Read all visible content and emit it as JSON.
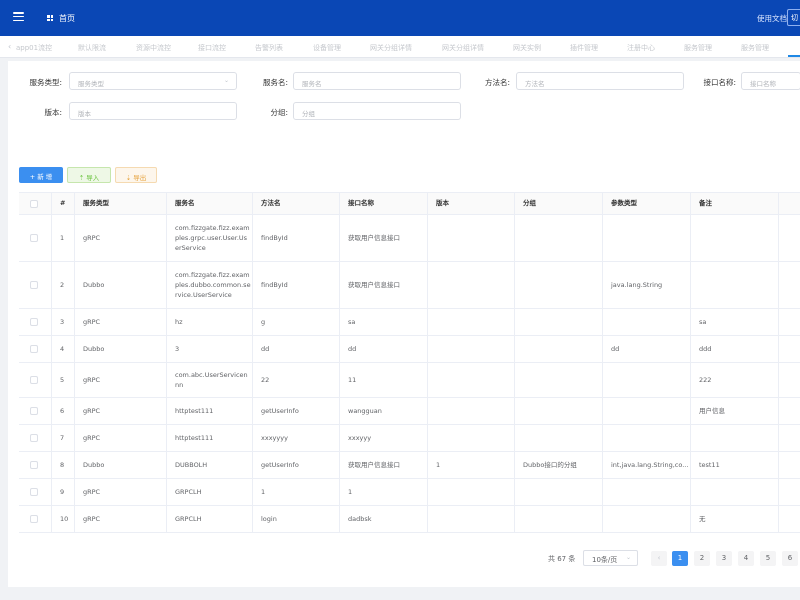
{
  "header": {
    "home_label": "首页",
    "docs_link": "使用文档",
    "right_box": "切"
  },
  "tabs": [
    "app01流控",
    "默认限流",
    "资源中流控",
    "接口流控",
    "告警列表",
    "设备管理",
    "网关分组详情",
    "网关分组详情",
    "网关实例",
    "插件管理",
    "注册中心",
    "服务管理",
    "服务管理"
  ],
  "filters": {
    "service_type": {
      "label": "服务类型:",
      "placeholder": "服务类型"
    },
    "service_name": {
      "label": "服务名:",
      "placeholder": "服务名"
    },
    "method_name": {
      "label": "方法名:",
      "placeholder": "方法名"
    },
    "interface_name": {
      "label": "接口名称:",
      "placeholder": "接口名称"
    },
    "version": {
      "label": "版本:",
      "placeholder": "版本"
    },
    "group": {
      "label": "分组:",
      "placeholder": "分组"
    }
  },
  "toolbar": {
    "add_label": "+ 新 增",
    "import_label": "⇡ 导入",
    "export_label": "⇣ 导出"
  },
  "table": {
    "columns": [
      "#",
      "服务类型",
      "服务名",
      "方法名",
      "接口名称",
      "版本",
      "分组",
      "参数类型",
      "备注"
    ],
    "rows": [
      {
        "index": "1",
        "type": "gRPC",
        "service": "com.fizzgate.fizz.examples.grpc.user.User.UserService",
        "method": "findById",
        "iface": "获取用户信息接口",
        "version": "",
        "group": "",
        "params": "",
        "note": ""
      },
      {
        "index": "2",
        "type": "Dubbo",
        "service": "com.fizzgate.fizz.examples.dubbo.common.service.UserService",
        "method": "findById",
        "iface": "获取用户信息接口",
        "version": "",
        "group": "",
        "params": "java.lang.String",
        "note": ""
      },
      {
        "index": "3",
        "type": "gRPC",
        "service": "hz",
        "method": "g",
        "iface": "sa",
        "version": "",
        "group": "",
        "params": "",
        "note": "sa"
      },
      {
        "index": "4",
        "type": "Dubbo",
        "service": "3",
        "method": "dd",
        "iface": "dd",
        "version": "",
        "group": "",
        "params": "dd",
        "note": "ddd"
      },
      {
        "index": "5",
        "type": "gRPC",
        "service": "com.abc.UserServicennn",
        "method": "22",
        "iface": "11",
        "version": "",
        "group": "",
        "params": "",
        "note": "222"
      },
      {
        "index": "6",
        "type": "gRPC",
        "service": "httptest111",
        "method": "getUserInfo",
        "iface": "wangguan",
        "version": "",
        "group": "",
        "params": "",
        "note": "用户信息"
      },
      {
        "index": "7",
        "type": "gRPC",
        "service": "httptest111",
        "method": "xxxyyyy",
        "iface": "xxxyyy",
        "version": "",
        "group": "",
        "params": "",
        "note": ""
      },
      {
        "index": "8",
        "type": "Dubbo",
        "service": "DUBBOLH",
        "method": "getUserInfo",
        "iface": "获取用户信息接口",
        "version": "1",
        "group": "Dubbo接口的分组",
        "params": "int,java.lang.String,co...",
        "note": "test11"
      },
      {
        "index": "9",
        "type": "gRPC",
        "service": "GRPCLH",
        "method": "1",
        "iface": "1",
        "version": "",
        "group": "",
        "params": "",
        "note": ""
      },
      {
        "index": "10",
        "type": "gRPC",
        "service": "GRPCLH",
        "method": "login",
        "iface": "dadbsk",
        "version": "",
        "group": "",
        "params": "",
        "note": "无"
      }
    ]
  },
  "pagination": {
    "total": "共 67 条",
    "page_size": "10条/页",
    "prev": "‹",
    "pages": [
      "1",
      "2",
      "3",
      "4",
      "5",
      "6"
    ],
    "active": "1"
  },
  "colors": {
    "header_bg": "#0a47b5",
    "primary": "#3b8ff0",
    "success": "#67c23a",
    "warning": "#e6a23c"
  }
}
